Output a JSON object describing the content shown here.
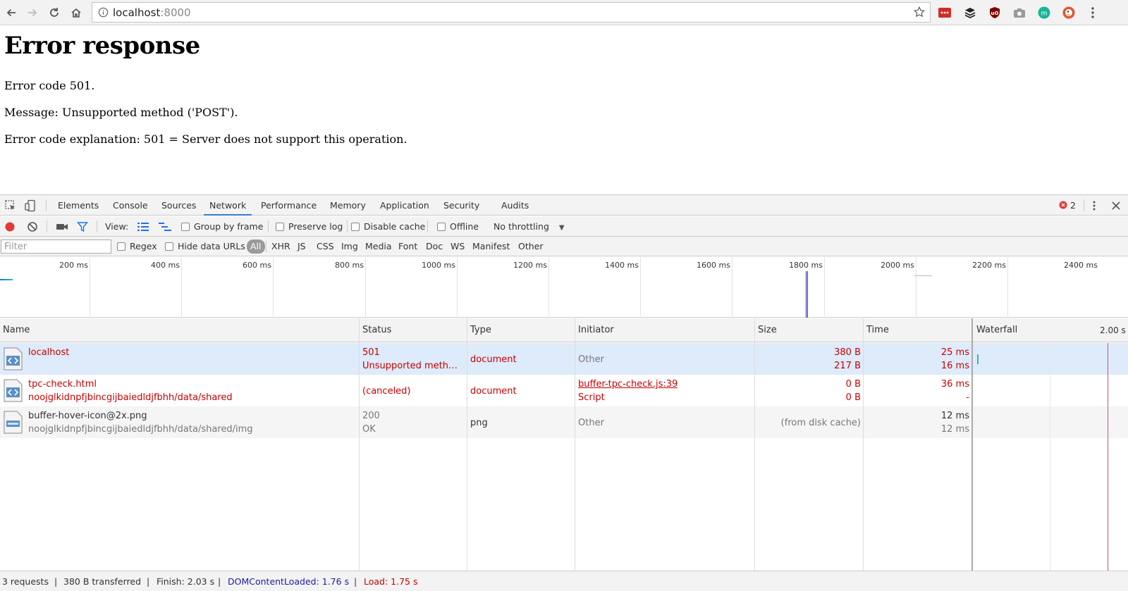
{
  "browser": {
    "url_host": "localhost",
    "url_port": ":8000"
  },
  "page": {
    "heading": "Error response",
    "line1": "Error code 501.",
    "line2": "Message: Unsupported method ('POST').",
    "line3": "Error code explanation: 501 = Server does not support this operation."
  },
  "devtools": {
    "tabs": [
      "Elements",
      "Console",
      "Sources",
      "Network",
      "Performance",
      "Memory",
      "Application",
      "Security",
      "Audits"
    ],
    "active_tab": "Network",
    "error_count": "2",
    "toolbar": {
      "view_label": "View:",
      "group_by_frame": "Group by frame",
      "preserve_log": "Preserve log",
      "disable_cache": "Disable cache",
      "offline": "Offline",
      "throttling": "No throttling"
    },
    "filter": {
      "placeholder": "Filter",
      "regex": "Regex",
      "hide_data_urls": "Hide data URLs",
      "types": [
        "All",
        "XHR",
        "JS",
        "CSS",
        "Img",
        "Media",
        "Font",
        "Doc",
        "WS",
        "Manifest",
        "Other"
      ]
    },
    "overview_ticks": [
      "200 ms",
      "400 ms",
      "600 ms",
      "800 ms",
      "1000 ms",
      "1200 ms",
      "1400 ms",
      "1600 ms",
      "1800 ms",
      "2000 ms",
      "2200 ms",
      "2400 ms"
    ],
    "columns": {
      "name": "Name",
      "status": "Status",
      "type": "Type",
      "initiator": "Initiator",
      "size": "Size",
      "time": "Time",
      "waterfall": "Waterfall",
      "waterfall_scale": "2.00 s"
    },
    "requests": [
      {
        "name": "localhost",
        "path": "",
        "status": "501",
        "status_text": "Unsupported metho…",
        "type": "document",
        "initiator": "Other",
        "initiator_sub": "",
        "size": "380 B",
        "size_sub": "217 B",
        "time": "25 ms",
        "time_sub": "16 ms"
      },
      {
        "name": "tpc-check.html",
        "path": "noojglkidnpfjbincgijbaiedldjfbhh/data/shared",
        "status": "(canceled)",
        "status_text": "",
        "type": "document",
        "initiator": "buffer-tpc-check.js:39",
        "initiator_sub": "Script",
        "size": "0 B",
        "size_sub": "0 B",
        "time": "36 ms",
        "time_sub": "-"
      },
      {
        "name": "buffer-hover-icon@2x.png",
        "path": "noojglkidnpfjbincgijbaiedldjfbhh/data/shared/img",
        "status": "200",
        "status_text": "OK",
        "type": "png",
        "initiator": "Other",
        "initiator_sub": "",
        "size": "(from disk cache)",
        "size_sub": "",
        "time": "12 ms",
        "time_sub": "12 ms"
      }
    ],
    "status_bar": {
      "requests": "3 requests",
      "transferred": "380 B transferred",
      "finish": "Finish: 2.03 s",
      "dom_content_loaded": "DOMContentLoaded: 1.76 s",
      "load": "Load: 1.75 s",
      "sep": "|"
    },
    "colors": {
      "error": "#c80000",
      "dom_content_loaded": "#1a1aa6",
      "selected_row": "#deebfb",
      "accent": "#3879d9"
    }
  }
}
